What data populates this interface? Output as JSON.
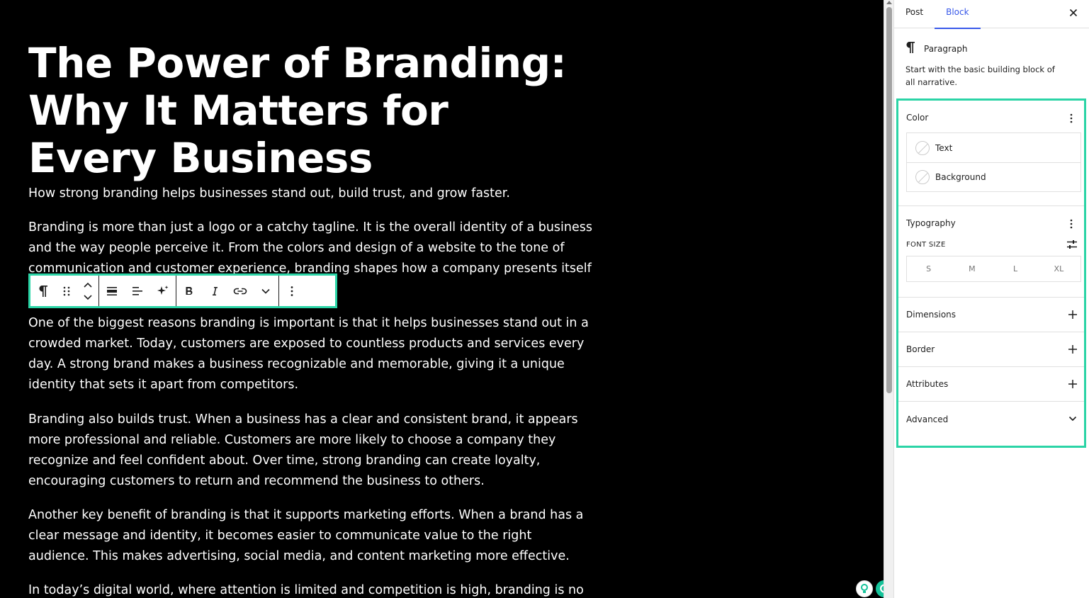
{
  "editor": {
    "title": "The Power of Branding: Why It Matters for Every Business",
    "subtitle": "How strong branding helps businesses stand out, build trust, and grow faster.",
    "paragraphs": [
      "Branding is more than just a logo or a catchy tagline. It is the overall identity of a business and the way people perceive it. From the colors and design of a website to the tone of communication and customer experience, branding shapes how a company presents itself to",
      "One of the biggest reasons branding is important is that it helps businesses stand out in a crowded market. Today, customers are exposed to countless products and services every day. A strong brand makes a business recognizable and memorable, giving it a unique identity that sets it apart from competitors.",
      "Branding also builds trust. When a business has a clear and consistent brand, it appears more professional and reliable. Customers are more likely to choose a company they recognize and feel confident about. Over time, strong branding can create loyalty, encouraging customers to return and recommend the business to others.",
      "Another key benefit of branding is that it supports marketing efforts. When a brand has a clear message and identity, it becomes easier to communicate value to the right audience. This makes advertising, social media, and content marketing more effective.",
      "In today’s digital world, where attention is limited and competition is high, branding is no"
    ]
  },
  "toolbar": {
    "groups": [
      [
        "paragraph-icon",
        "drag-handle-icon",
        "move-up-down-icon"
      ],
      [
        "align-block-icon",
        "align-text-icon",
        "ai-sparkle-icon"
      ],
      [
        "bold-icon",
        "italic-icon",
        "link-icon",
        "more-rich-text-icon"
      ],
      [
        "options-icon"
      ]
    ]
  },
  "sidebar": {
    "tabs": [
      "Post",
      "Block"
    ],
    "active_tab": "Block",
    "block": {
      "name": "Paragraph",
      "description": "Start with the basic building block of all narrative."
    },
    "color": {
      "title": "Color",
      "items": [
        "Text",
        "Background"
      ]
    },
    "typography": {
      "title": "Typography",
      "font_size_label": "FONT SIZE",
      "sizes": [
        "S",
        "M",
        "L",
        "XL"
      ]
    },
    "panels": [
      "Dimensions",
      "Border",
      "Attributes"
    ],
    "advanced": "Advanced"
  },
  "colors": {
    "accent": "#3858e9",
    "highlight_border": "#2bd4a6",
    "canvas_bg": "#000000",
    "grammarly": "#15c39a"
  }
}
